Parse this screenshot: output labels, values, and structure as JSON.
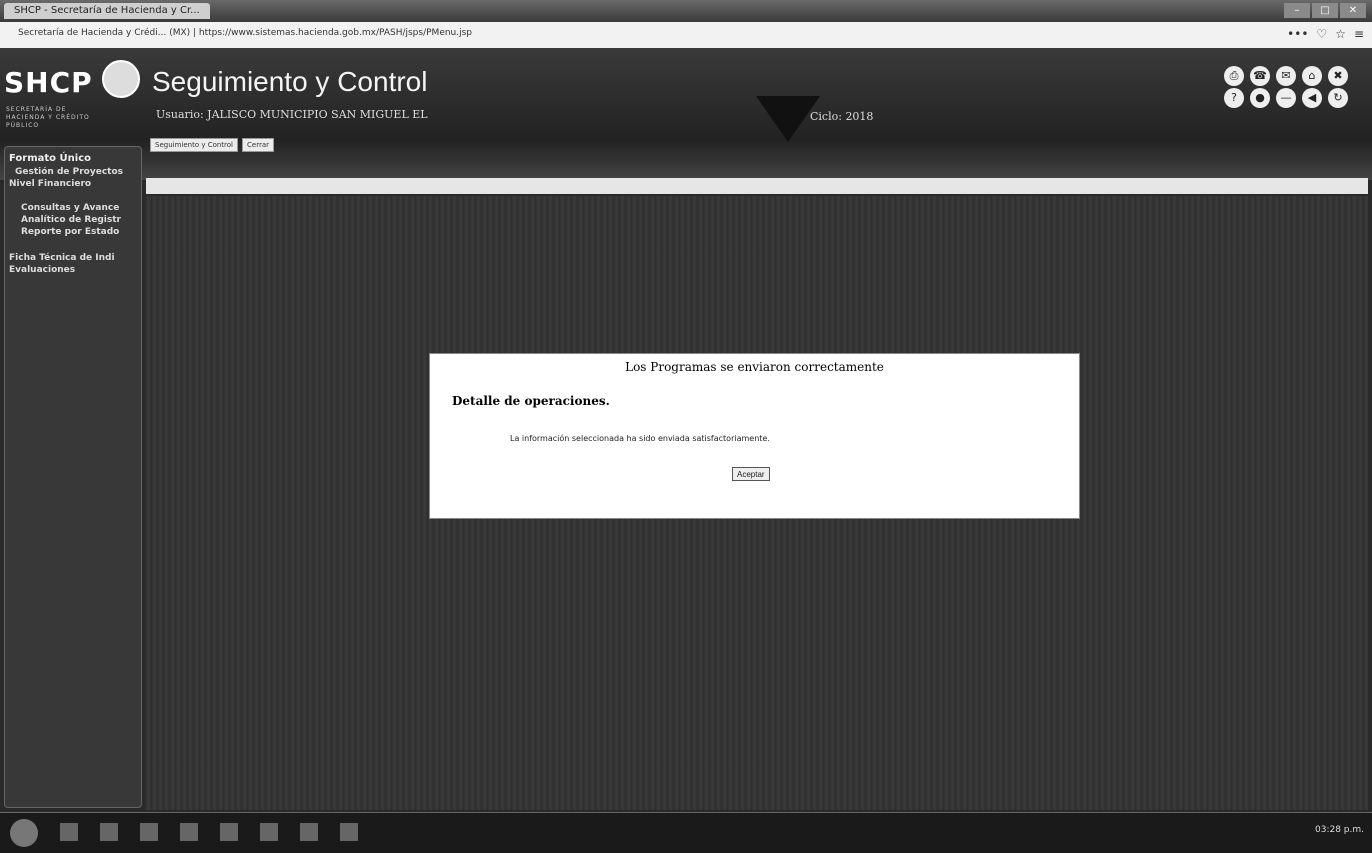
{
  "browser": {
    "tab_title": "SHCP - Secretaría de Hacienda y Cr...",
    "url_text": "Secretaría de Hacienda y Crédi... (MX) | https://www.sistemas.hacienda.gob.mx/PASH/jsps/PMenu.jsp",
    "window_buttons": [
      "–",
      "□",
      "✕"
    ],
    "toolbar_icons": [
      "•••",
      "♡",
      "☆",
      "≡"
    ]
  },
  "header": {
    "logo": "SHCP",
    "logo_subtitle": "SECRETARÍA DE HACIENDA Y CRÉDITO PÚBLICO",
    "app_title": "Seguimiento y Control",
    "usuario": "Usuario: JALISCO MUNICIPIO SAN MIGUEL EL",
    "ciclo": "Ciclo: 2018",
    "nav": [
      "Seguimiento y Control",
      "Cerrar"
    ],
    "action_icons": [
      "⎙",
      "☎",
      "✉",
      "⌂",
      "✖",
      "?",
      "●",
      "—",
      "◀",
      "↻"
    ]
  },
  "sidebar": {
    "items": [
      {
        "label": "Formato Único",
        "level": 0
      },
      {
        "label": "Gestión de Proyectos",
        "level": 1
      },
      {
        "label": "Nivel Financiero",
        "level": 1
      },
      {
        "label": "Consultas y Avance",
        "level": 2
      },
      {
        "label": "Analítico de Registr",
        "level": 2
      },
      {
        "label": "Reporte por Estado",
        "level": 2
      },
      {
        "label": "Ficha Técnica de Indi",
        "level": 0
      },
      {
        "label": "Evaluaciones",
        "level": 0
      }
    ]
  },
  "dialog": {
    "title": "Los Programas se enviaron correctamente",
    "heading": "Detalle de operaciones.",
    "message": "La información seleccionada ha sido enviada satisfactoriamente.",
    "button": "Aceptar"
  },
  "taskbar": {
    "clock": "03:28 p.m."
  }
}
